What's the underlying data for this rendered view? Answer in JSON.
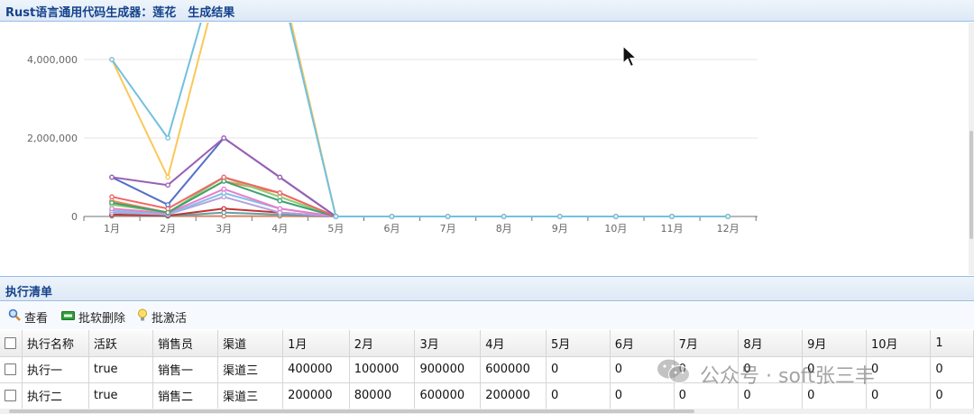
{
  "window": {
    "title": "Rust语言通用代码生成器：莲花　生成结果"
  },
  "chart_data": {
    "type": "line",
    "categories": [
      "1月",
      "2月",
      "3月",
      "4月",
      "5月",
      "6月",
      "7月",
      "8月",
      "9月",
      "10月",
      "11月",
      "12月"
    ],
    "y_ticks": [
      0,
      2000000,
      4000000
    ],
    "y_tick_labels": [
      "0",
      "2,000,000",
      "4,000,000"
    ],
    "ylim": [
      0,
      4400000
    ],
    "grid": true,
    "series": [
      {
        "color": "#73c0de",
        "values": [
          4000000,
          2000000,
          7000000,
          6000000,
          0,
          0,
          0,
          0,
          0,
          0,
          0,
          0
        ]
      },
      {
        "color": "#fac858",
        "values": [
          4000000,
          1000000,
          6500000,
          6200000,
          0,
          0,
          0,
          0,
          0,
          0,
          0,
          0
        ]
      },
      {
        "color": "#9a60b4",
        "values": [
          1000000,
          800000,
          2000000,
          1000000,
          0,
          0,
          0,
          0,
          0,
          0,
          0,
          0
        ]
      },
      {
        "color": "#5470c6",
        "values": [
          1000000,
          300000,
          2000000,
          1000000,
          0,
          0,
          0,
          0,
          0,
          0,
          0,
          0
        ]
      },
      {
        "color": "#ee6666",
        "values": [
          500000,
          200000,
          1000000,
          600000,
          0,
          0,
          0,
          0,
          0,
          0,
          0,
          0
        ]
      },
      {
        "color": "#3ba272",
        "values": [
          350000,
          100000,
          900000,
          400000,
          0,
          0,
          0,
          0,
          0,
          0,
          0,
          0
        ]
      },
      {
        "color": "#91cc75",
        "values": [
          300000,
          100000,
          1000000,
          500000,
          0,
          0,
          0,
          0,
          0,
          0,
          0,
          0
        ]
      },
      {
        "color": "#fc8452",
        "values": [
          400000,
          100000,
          900000,
          600000,
          0,
          0,
          0,
          0,
          0,
          0,
          0,
          0
        ]
      },
      {
        "color": "#ea7ccc",
        "values": [
          200000,
          80000,
          700000,
          200000,
          0,
          0,
          0,
          0,
          0,
          0,
          0,
          0
        ]
      },
      {
        "color": "#7fc1e8",
        "values": [
          150000,
          50000,
          600000,
          200000,
          0,
          0,
          0,
          0,
          0,
          0,
          0,
          0
        ]
      },
      {
        "color": "#b6a2de",
        "values": [
          100000,
          50000,
          500000,
          100000,
          0,
          0,
          0,
          0,
          0,
          0,
          0,
          0
        ]
      },
      {
        "color": "#c23531",
        "values": [
          50000,
          20000,
          200000,
          100000,
          0,
          0,
          0,
          0,
          0,
          0,
          0,
          0
        ]
      },
      {
        "color": "#61a0a8",
        "values": [
          30000,
          10000,
          100000,
          50000,
          0,
          0,
          0,
          0,
          0,
          0,
          0,
          0
        ]
      },
      {
        "color": "#d48265",
        "values": [
          10000,
          10000,
          10000,
          10000,
          0,
          0,
          0,
          0,
          0,
          0,
          0,
          0
        ]
      }
    ]
  },
  "list_panel": {
    "title": "执行清单"
  },
  "toolbar": {
    "view_label": "查看",
    "soft_delete_label": "批软删除",
    "activate_label": "批激活"
  },
  "table": {
    "columns": [
      "执行名称",
      "活跃",
      "销售员",
      "渠道",
      "1月",
      "2月",
      "3月",
      "4月",
      "5月",
      "6月",
      "7月",
      "8月",
      "9月",
      "10月",
      "1"
    ],
    "rows": [
      [
        "执行一",
        "true",
        "销售一",
        "渠道三",
        "400000",
        "100000",
        "900000",
        "600000",
        "0",
        "0",
        "0",
        "0",
        "0",
        "0",
        "0"
      ],
      [
        "执行二",
        "true",
        "销售二",
        "渠道三",
        "200000",
        "80000",
        "600000",
        "200000",
        "0",
        "0",
        "0",
        "0",
        "0",
        "0",
        "0"
      ]
    ]
  },
  "watermark": {
    "text": "公众号 · soft张三丰"
  }
}
